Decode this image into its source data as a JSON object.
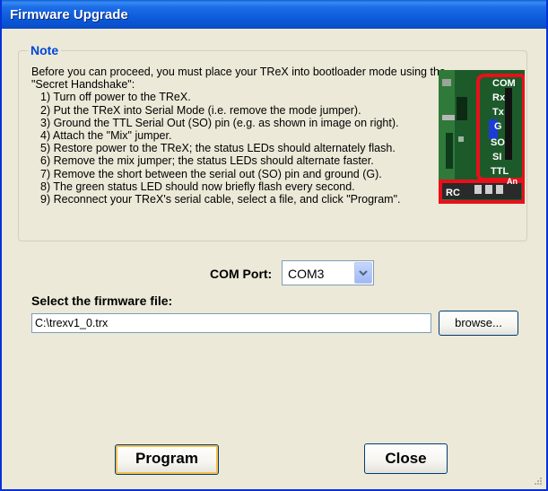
{
  "window": {
    "title": "Firmware Upgrade"
  },
  "note": {
    "legend": "Note",
    "intro": "Before you can proceed, you must place your TReX into bootloader mode using the \"Secret Handshake\":",
    "steps": [
      "1) Turn off power to the TReX.",
      "2) Put the TReX into Serial Mode (i.e. remove the mode jumper).",
      "3) Ground the TTL Serial Out (SO) pin (e.g. as shown in image on right).",
      "4) Attach the \"Mix\" jumper.",
      "5) Restore power to the TReX; the status LEDs should alternately flash.",
      "6) Remove the mix jumper; the status LEDs should alternate faster.",
      "7) Remove the short between the serial out (SO) pin and ground (G).",
      "8) The green status LED should now briefly flash every second.",
      "9) Reconnect your TReX's serial cable, select a file, and click \"Program\"."
    ],
    "image": {
      "labels": [
        "COM",
        "Rx",
        "Tx",
        "G",
        "SO",
        "SI",
        "TTL",
        "RC",
        "An"
      ]
    }
  },
  "com_port": {
    "label": "COM Port:",
    "value": "COM3"
  },
  "firmware": {
    "label": "Select the firmware file:",
    "path": "C:\\trexv1_0.trx",
    "browse_label": "browse..."
  },
  "buttons": {
    "program_label": "Program",
    "close_label": "Close"
  },
  "colors": {
    "titlebar": "#0a58d8",
    "legend": "#0046d5",
    "dialog_bg": "#ece9d8",
    "highlight": "#e8101a"
  }
}
